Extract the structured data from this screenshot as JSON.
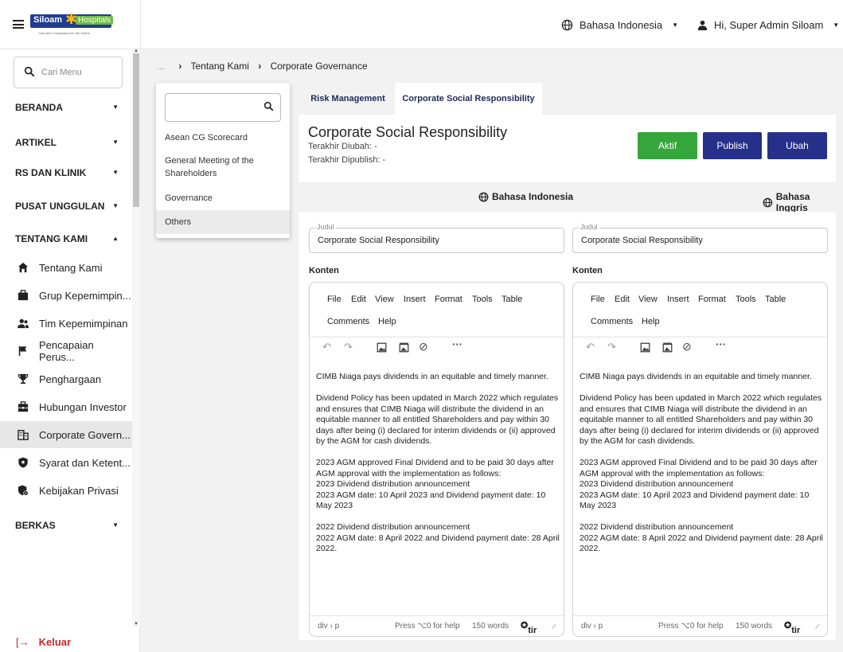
{
  "header": {
    "logo_text": "Siloam",
    "logo_sub": "Hospitals",
    "logo_tagline": "Care and Compassion for the Nation",
    "language": "Bahasa Indonesia",
    "user": "Hi, Super Admin Siloam"
  },
  "sidebar": {
    "search_placeholder": "Cari Menu",
    "sections": {
      "beranda": "BERANDA",
      "artikel": "ARTIKEL",
      "rs": "RS DAN KLINIK",
      "pusat": "PUSAT UNGGULAN",
      "tentang": "TENTANG KAMI",
      "berkas": "BERKAS"
    },
    "items": [
      {
        "label": "Tentang Kami",
        "icon": "home-icon"
      },
      {
        "label": "Grup Kepemimpin...",
        "icon": "briefcase-icon"
      },
      {
        "label": "Tim Kepemimpinan",
        "icon": "group-icon"
      },
      {
        "label": "Pencapaian Perus...",
        "icon": "flag-icon"
      },
      {
        "label": "Penghargaan",
        "icon": "trophy-icon"
      },
      {
        "label": "Hubungan Investor",
        "icon": "work-icon"
      },
      {
        "label": "Corporate Govern...",
        "icon": "building-icon"
      },
      {
        "label": "Syarat dan Ketent...",
        "icon": "shield-icon"
      },
      {
        "label": "Kebijakan Privasi",
        "icon": "privacy-icon"
      }
    ],
    "logout": "Keluar"
  },
  "breadcrumb": {
    "dots": "...",
    "level1": "Tentang Kami",
    "level2": "Corporate Governance"
  },
  "dropdown": {
    "items": [
      "Asean CG Scorecard",
      "General Meeting of the Shareholders",
      "Governance",
      "Others"
    ]
  },
  "tabs": [
    "Risk Management",
    "Corporate Social Responsibility"
  ],
  "content": {
    "title": "Corporate Social Responsibility",
    "last_modified": "Terakhir Diubah: -",
    "last_published": "Terakhir Dipublish: -",
    "btn_aktif": "Aktif",
    "btn_publish": "Publish",
    "btn_ubah": "Ubah",
    "lang_id": "Bahasa Indonesia",
    "lang_en": "Bahasa Inggris"
  },
  "editor": {
    "judul_label": "Judul",
    "judul_value": "Corporate Social Responsibility",
    "konten_label": "Konten",
    "menu": [
      "File",
      "Edit",
      "View",
      "Insert",
      "Format",
      "Tools",
      "Table",
      "Comments",
      "Help"
    ],
    "p1": "CIMB Niaga pays dividends in an equitable and timely manner.",
    "p2": "Dividend Policy has been updated in March 2022 which regulates and ensures that CIMB Niaga will distribute the dividend in an equitable manner to all entitled Shareholders and pay within 30 days after being (i) declared for interim dividends or (ii) approved by the AGM for cash dividends.",
    "p3a": "2023 AGM approved Final Dividend and to be paid 30 days after AGM approval with the implementation as follows:",
    "p3b": "2023 Dividend distribution announcement",
    "p3c": "2023 AGM date: 10 April 2023 and Dividend payment date: 10 May 2023",
    "p4a": "2022 Dividend distribution announcement",
    "p4b": "2022 AGM date: 8 April 2022 and Dividend payment date: 28 April 2022.",
    "path": "div › p",
    "help": "Press ⌥0 for help",
    "words": "150 words",
    "brand": "tir"
  }
}
